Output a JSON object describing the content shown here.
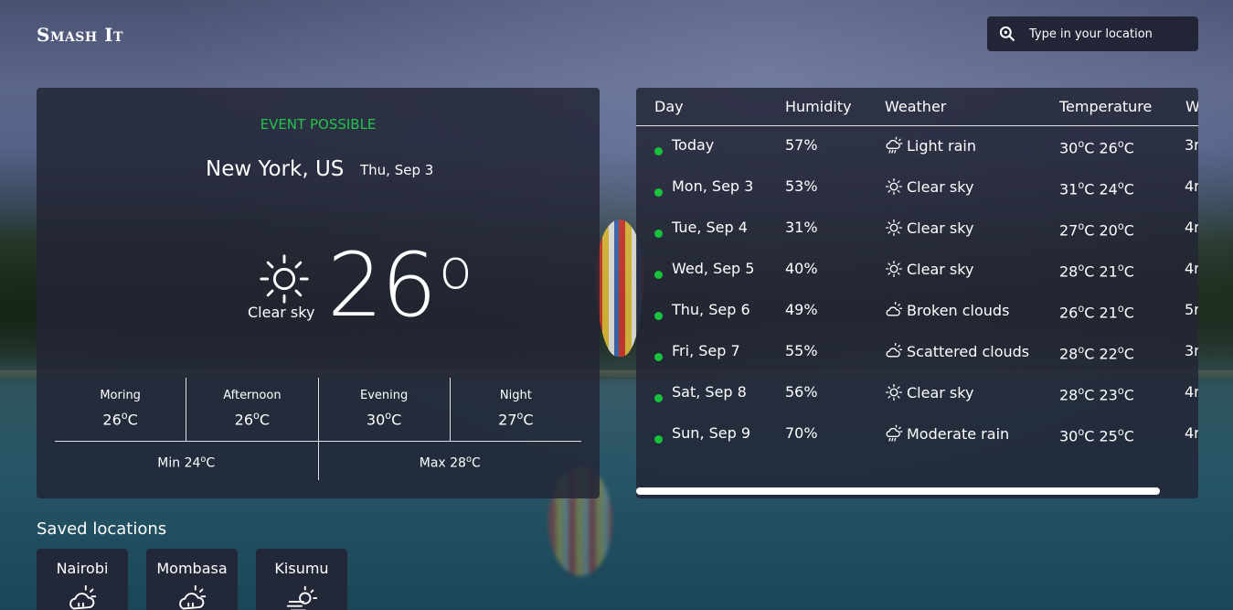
{
  "app": {
    "logo": "Smash It"
  },
  "search": {
    "placeholder": "Type in your location"
  },
  "current": {
    "status": "EVENT POSSIBLE",
    "status_color": "#24c24a",
    "location": "New York, US",
    "date": "Thu, Sep 3",
    "condition": "Clear sky",
    "condition_icon": "sun-icon",
    "temperature": "26",
    "periods": [
      {
        "label": "Moring",
        "temp": "26"
      },
      {
        "label": "Afternoon",
        "temp": "26"
      },
      {
        "label": "Evening",
        "temp": "30"
      },
      {
        "label": "Night",
        "temp": "27"
      }
    ],
    "min_label": "Min",
    "min_temp": "24",
    "max_label": "Max",
    "max_temp": "28"
  },
  "forecast": {
    "headers": [
      "Day",
      "Humidity",
      "Weather",
      "Temperature",
      "W"
    ],
    "rows": [
      {
        "day": "Today",
        "humidity": "57%",
        "icon": "rain-cloud-icon",
        "weather": "Light rain",
        "high": "30",
        "low": "26",
        "wind": "3r"
      },
      {
        "day": "Mon, Sep 3",
        "humidity": "53%",
        "icon": "sun-icon",
        "weather": "Clear sky",
        "high": "31",
        "low": "24",
        "wind": "4r"
      },
      {
        "day": "Tue, Sep 4",
        "humidity": "31%",
        "icon": "sun-icon",
        "weather": "Clear sky",
        "high": "27",
        "low": "20",
        "wind": "4r"
      },
      {
        "day": "Wed, Sep 5",
        "humidity": "40%",
        "icon": "sun-icon",
        "weather": "Clear sky",
        "high": "28",
        "low": "21",
        "wind": "4r"
      },
      {
        "day": "Thu, Sep 6",
        "humidity": "49%",
        "icon": "cloud-sun-icon",
        "weather": "Broken clouds",
        "high": "26",
        "low": "21",
        "wind": "5r"
      },
      {
        "day": "Fri, Sep 7",
        "humidity": "55%",
        "icon": "cloud-sun-icon",
        "weather": "Scattered clouds",
        "high": "28",
        "low": "22",
        "wind": "3r"
      },
      {
        "day": "Sat, Sep 8",
        "humidity": "56%",
        "icon": "sun-icon",
        "weather": "Clear sky",
        "high": "28",
        "low": "23",
        "wind": "4r"
      },
      {
        "day": "Sun, Sep 9",
        "humidity": "70%",
        "icon": "rain-cloud-icon",
        "weather": "Moderate rain",
        "high": "30",
        "low": "25",
        "wind": "4r"
      }
    ],
    "status_dot_color": "#19c23d"
  },
  "saved": {
    "title": "Saved locations",
    "locations": [
      {
        "name": "Nairobi",
        "icon": "cloud-sun-rain-icon"
      },
      {
        "name": "Mombasa",
        "icon": "cloud-sun-rain-icon"
      },
      {
        "name": "Kisumu",
        "icon": "wind-sun-icon"
      }
    ]
  }
}
